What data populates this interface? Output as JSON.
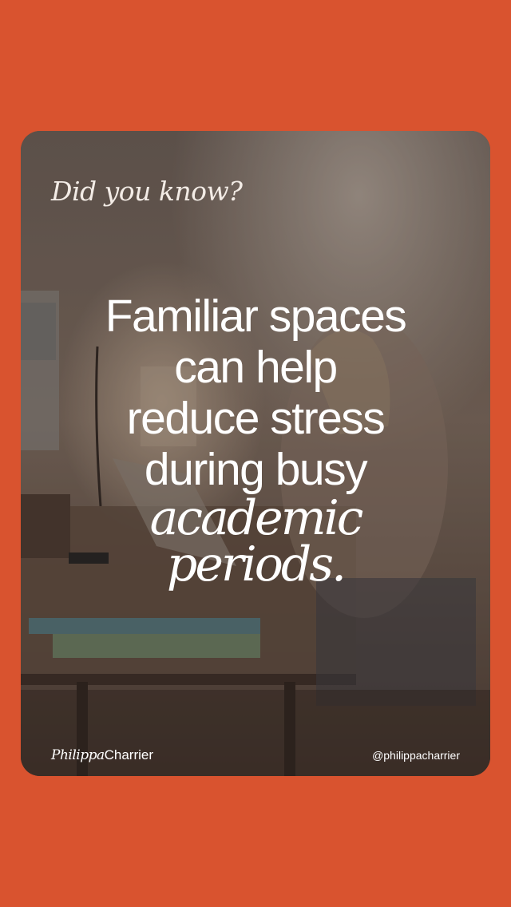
{
  "card": {
    "kicker": "Did you know?",
    "headline_lines": [
      "Familiar spaces",
      "can help",
      "reduce stress",
      "during busy"
    ],
    "headline_italic_lines": [
      "academic",
      "periods."
    ],
    "footer": {
      "brand_first": "Philippa",
      "brand_last": "Charrier",
      "handle": "@philippacharrier"
    }
  },
  "colors": {
    "background": "#d9532f",
    "text": "#ffffff"
  }
}
